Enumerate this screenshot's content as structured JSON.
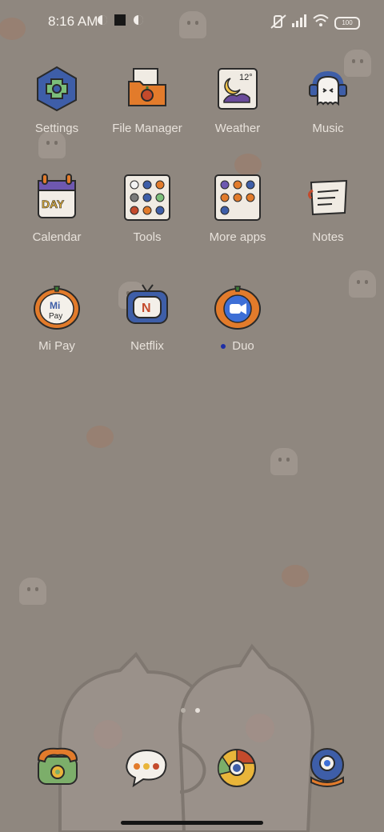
{
  "status": {
    "time": "8:16 AM",
    "battery": "100"
  },
  "apps": [
    {
      "label": "Settings",
      "icon": "settings-icon"
    },
    {
      "label": "File Manager",
      "icon": "folder-icon"
    },
    {
      "label": "Weather",
      "icon": "weather-icon",
      "text": "12°"
    },
    {
      "label": "Music",
      "icon": "music-headphones-icon"
    },
    {
      "label": "Calendar",
      "icon": "calendar-icon",
      "text": "DAY"
    },
    {
      "label": "Tools",
      "icon": "folder-grid-icon"
    },
    {
      "label": "More apps",
      "icon": "folder-grid-icon"
    },
    {
      "label": "Notes",
      "icon": "notes-icon"
    },
    {
      "label": "Mi Pay",
      "icon": "mi-pay-icon",
      "text1": "Mi",
      "text2": "Pay"
    },
    {
      "label": "Netflix",
      "icon": "netflix-icon",
      "text": "N"
    },
    {
      "label": "Duo",
      "icon": "duo-icon",
      "badge": "new"
    }
  ],
  "dock": [
    {
      "label": "Phone",
      "icon": "phone-icon"
    },
    {
      "label": "Messages",
      "icon": "messages-icon"
    },
    {
      "label": "Chrome",
      "icon": "chrome-icon"
    },
    {
      "label": "Camera",
      "icon": "camera-icon"
    }
  ],
  "colors": {
    "background": "#8f877f",
    "accent_orange": "#e27b2b",
    "accent_blue": "#3f64a8"
  }
}
